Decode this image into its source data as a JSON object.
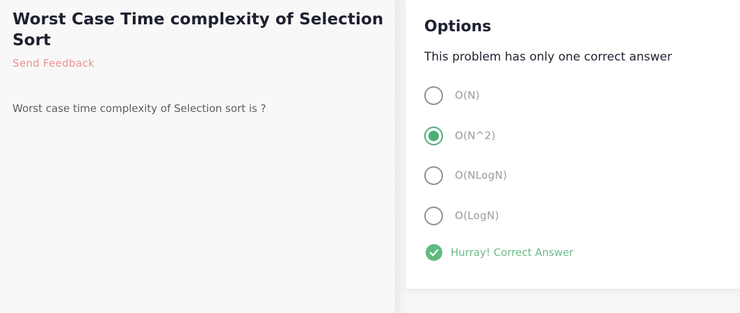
{
  "problem": {
    "title": "Worst Case Time complexity of Selection Sort",
    "feedback_label": "Send Feedback",
    "question": "Worst case time complexity of Selection sort is ?"
  },
  "options_panel": {
    "title": "Options",
    "subtitle": "This problem has only one correct answer",
    "options": [
      {
        "label": "O(N)",
        "selected": false
      },
      {
        "label": "O(N^2)",
        "selected": true
      },
      {
        "label": "O(NLogN)",
        "selected": false
      },
      {
        "label": "O(LogN)",
        "selected": false
      }
    ],
    "result_message": "Hurray! Correct Answer"
  },
  "colors": {
    "accent_green": "#4caf72",
    "feedback_red": "#f0928e",
    "title_dark": "#1f2130"
  },
  "icons": {
    "radio_unselected": "radio-empty-icon",
    "radio_selected": "radio-selected-icon",
    "result": "check-circle-icon"
  }
}
